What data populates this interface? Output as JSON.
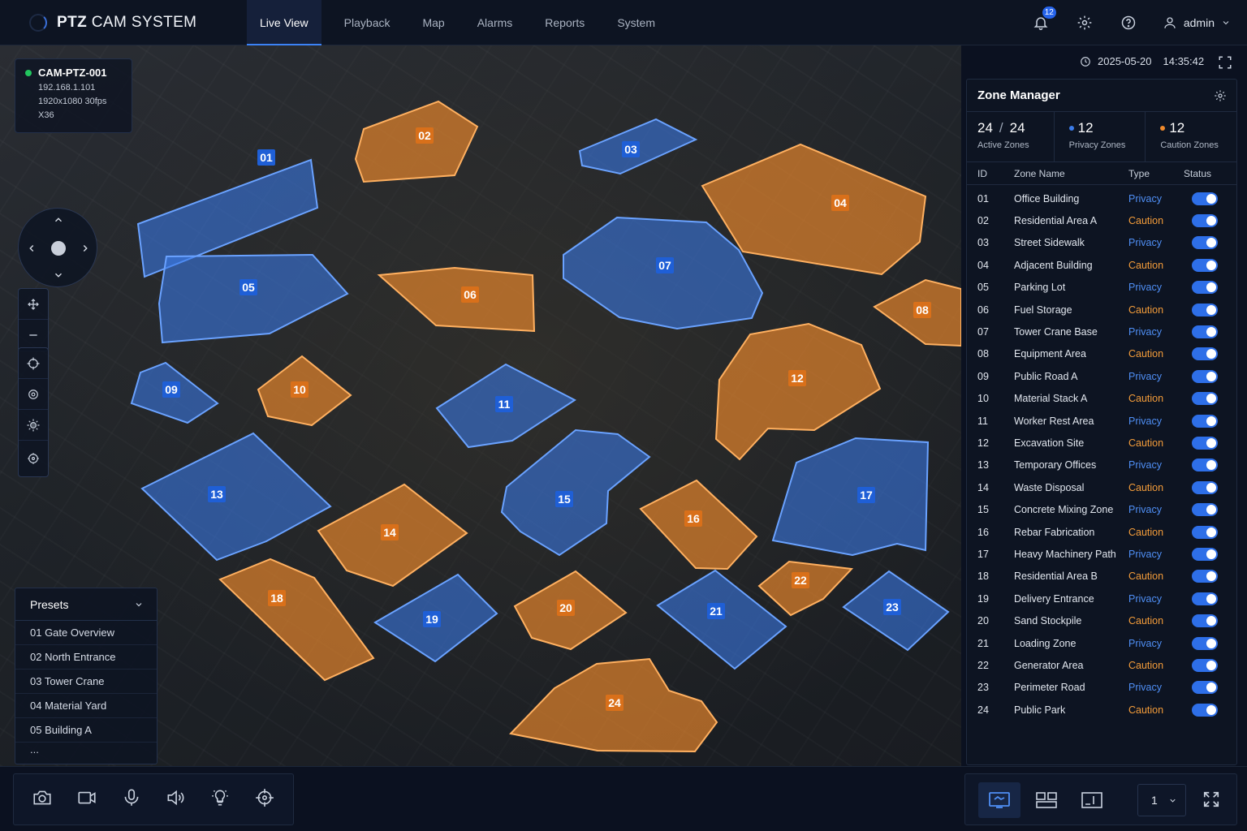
{
  "app": {
    "brand_bold": "PTZ",
    "brand_rest": "CAM SYSTEM"
  },
  "nav": {
    "tabs": [
      "Live View",
      "Playback",
      "Map",
      "Alarms",
      "Reports",
      "System"
    ],
    "active": "Live View"
  },
  "header": {
    "notification_count": "12",
    "user": "admin"
  },
  "camera": {
    "name": "CAM-PTZ-001",
    "ip": "192.168.1.101",
    "resolution": "1920x1080  30fps",
    "zoom": "X36"
  },
  "datetime": {
    "date": "2025-05-20",
    "time": "14:35:42"
  },
  "presets": {
    "title": "Presets",
    "items": [
      "01  Gate Overview",
      "02  North Entrance",
      "03  Tower Crane",
      "04  Material Yard",
      "05  Building A"
    ],
    "more": "..."
  },
  "zone_manager": {
    "title": "Zone Manager",
    "stats": {
      "active_value": "24",
      "active_total": "24",
      "active_label": "Active Zones",
      "privacy_value": "12",
      "privacy_label": "Privacy Zones",
      "caution_value": "12",
      "caution_label": "Caution Zones"
    },
    "columns": [
      "ID",
      "Zone Name",
      "Type",
      "Status"
    ],
    "zones": [
      {
        "id": "01",
        "name": "Office Building",
        "type": "Privacy"
      },
      {
        "id": "02",
        "name": "Residential Area A",
        "type": "Caution"
      },
      {
        "id": "03",
        "name": "Street Sidewalk",
        "type": "Privacy"
      },
      {
        "id": "04",
        "name": "Adjacent Building",
        "type": "Caution"
      },
      {
        "id": "05",
        "name": "Parking Lot",
        "type": "Privacy"
      },
      {
        "id": "06",
        "name": "Fuel Storage",
        "type": "Caution"
      },
      {
        "id": "07",
        "name": "Tower Crane Base",
        "type": "Privacy"
      },
      {
        "id": "08",
        "name": "Equipment Area",
        "type": "Caution"
      },
      {
        "id": "09",
        "name": "Public Road A",
        "type": "Privacy"
      },
      {
        "id": "10",
        "name": "Material Stack A",
        "type": "Caution"
      },
      {
        "id": "11",
        "name": "Worker Rest Area",
        "type": "Privacy"
      },
      {
        "id": "12",
        "name": "Excavation Site",
        "type": "Caution"
      },
      {
        "id": "13",
        "name": "Temporary Offices",
        "type": "Privacy"
      },
      {
        "id": "14",
        "name": "Waste Disposal",
        "type": "Caution"
      },
      {
        "id": "15",
        "name": "Concrete Mixing Zone",
        "type": "Privacy"
      },
      {
        "id": "16",
        "name": "Rebar Fabrication",
        "type": "Caution"
      },
      {
        "id": "17",
        "name": "Heavy Machinery Path",
        "type": "Privacy"
      },
      {
        "id": "18",
        "name": "Residential Area B",
        "type": "Caution"
      },
      {
        "id": "19",
        "name": "Delivery Entrance",
        "type": "Privacy"
      },
      {
        "id": "20",
        "name": "Sand Stockpile",
        "type": "Caution"
      },
      {
        "id": "21",
        "name": "Loading Zone",
        "type": "Privacy"
      },
      {
        "id": "22",
        "name": "Generator Area",
        "type": "Caution"
      },
      {
        "id": "23",
        "name": "Perimeter Road",
        "type": "Privacy"
      },
      {
        "id": "24",
        "name": "Public Park",
        "type": "Caution"
      }
    ]
  },
  "bottom": {
    "page_value": "1"
  },
  "colors": {
    "privacy": "#3b7be8",
    "caution": "#f08a2c",
    "accent": "#2563eb",
    "online": "#22c55e"
  },
  "icons": {
    "top": [
      "bell-icon",
      "gear-icon",
      "help-icon",
      "user-icon"
    ],
    "ptz_tools": [
      "move-icon",
      "zoom-out-icon",
      "crosshair-icon",
      "target-icon",
      "sun-icon",
      "settings-target-icon"
    ],
    "bottom": [
      "camera-icon",
      "video-icon",
      "microphone-icon",
      "speaker-icon",
      "light-bulb-icon",
      "crosshair-icon"
    ],
    "layout": [
      "single-view-icon",
      "grid-view-icon",
      "split-view-icon",
      "fullscreen-icon"
    ]
  }
}
